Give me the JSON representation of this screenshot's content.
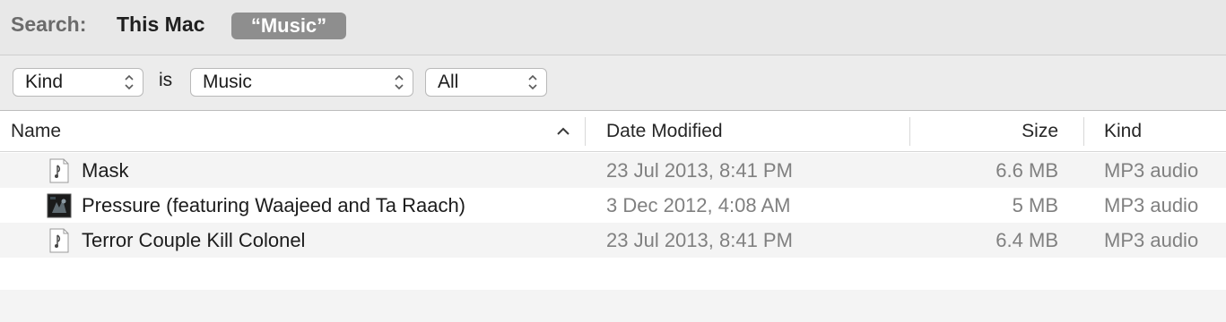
{
  "scope": {
    "label": "Search:",
    "this_mac": "This Mac",
    "query_token": "“Music”"
  },
  "criteria": {
    "attribute": "Kind",
    "operator": "is",
    "value": "Music",
    "scope_filter": "All"
  },
  "columns": {
    "name": "Name",
    "date": "Date Modified",
    "size": "Size",
    "kind": "Kind"
  },
  "files": [
    {
      "name": "Mask",
      "date": "23 Jul 2013, 8:41 PM",
      "size": "6.6 MB",
      "kind": "MP3 audio",
      "icon": "mp3-document-icon"
    },
    {
      "name": "Pressure (featuring Waajeed and Ta Raach)",
      "date": "3 Dec 2012, 4:08 AM",
      "size": "5 MB",
      "kind": "MP3 audio",
      "icon": "album-art-icon"
    },
    {
      "name": "Terror Couple Kill Colonel",
      "date": "23 Jul 2013, 8:41 PM",
      "size": "6.4 MB",
      "kind": "MP3 audio",
      "icon": "mp3-document-icon"
    }
  ],
  "colors": {
    "scope_token_bg": "#8e8e8e",
    "row_alt_bg": "#f4f4f4",
    "secondary_text": "#808080"
  }
}
